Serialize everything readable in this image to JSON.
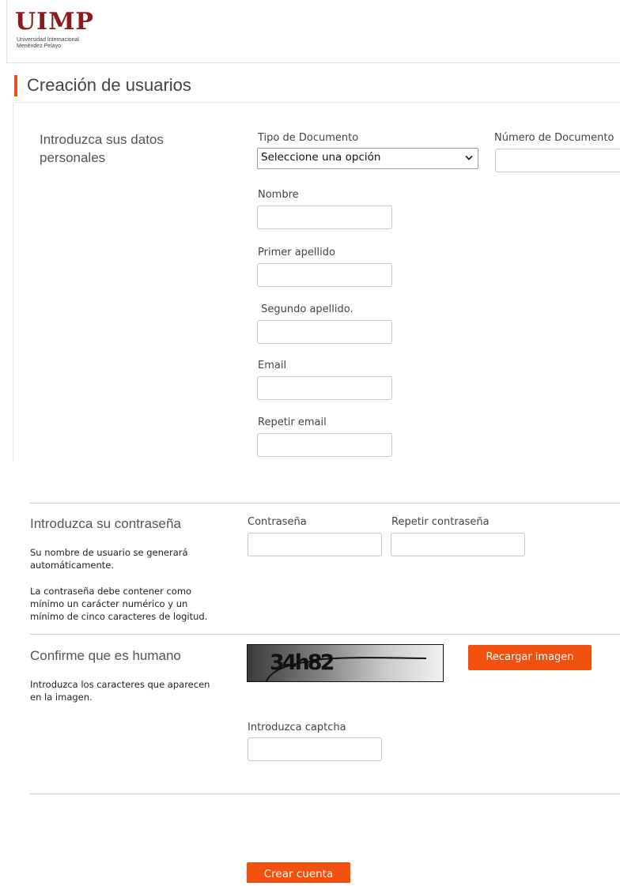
{
  "header": {
    "logo_text": "UIMP",
    "logo_line1": "Universidad Internacional",
    "logo_line2": "Menéndez Pelayo"
  },
  "page_title": "Creación de usuarios",
  "personal": {
    "heading_line1": "Introduzca sus datos",
    "heading_line2": "personales",
    "doc_type_label": "Tipo de Documento",
    "doc_type_value": "Seleccione una opción",
    "doc_number_label": "Número de Documento",
    "name_label": "Nombre",
    "first_surname_label": "Primer apellido",
    "second_surname_label": " Segundo apellido.",
    "email_label": "Email",
    "repeat_email_label": "Repetir email"
  },
  "password": {
    "heading": "Introduzca su contraseña",
    "help1_line1": "Su nombre de usuario se generará",
    "help1_line2": "automáticamente.",
    "help2_line1": "La contraseña debe contener como",
    "help2_line2": "mínimo un carácter numérico y un",
    "help2_line3": "mínimo de cinco caracteres de logitud.",
    "password_label": "Contraseña",
    "repeat_password_label": "Repetir contraseña"
  },
  "captcha": {
    "heading": "Confirme que es humano",
    "help_line1": "Introduzca los caracteres que aparecen",
    "help_line2": "en la imagen.",
    "image_text": "34h82",
    "reload_label": "Recargar imagen",
    "input_label": "Introduzca captcha"
  },
  "submit_label": "Crear cuenta",
  "colors": {
    "accent": "#f2500f",
    "logo": "#8b1a1f"
  }
}
